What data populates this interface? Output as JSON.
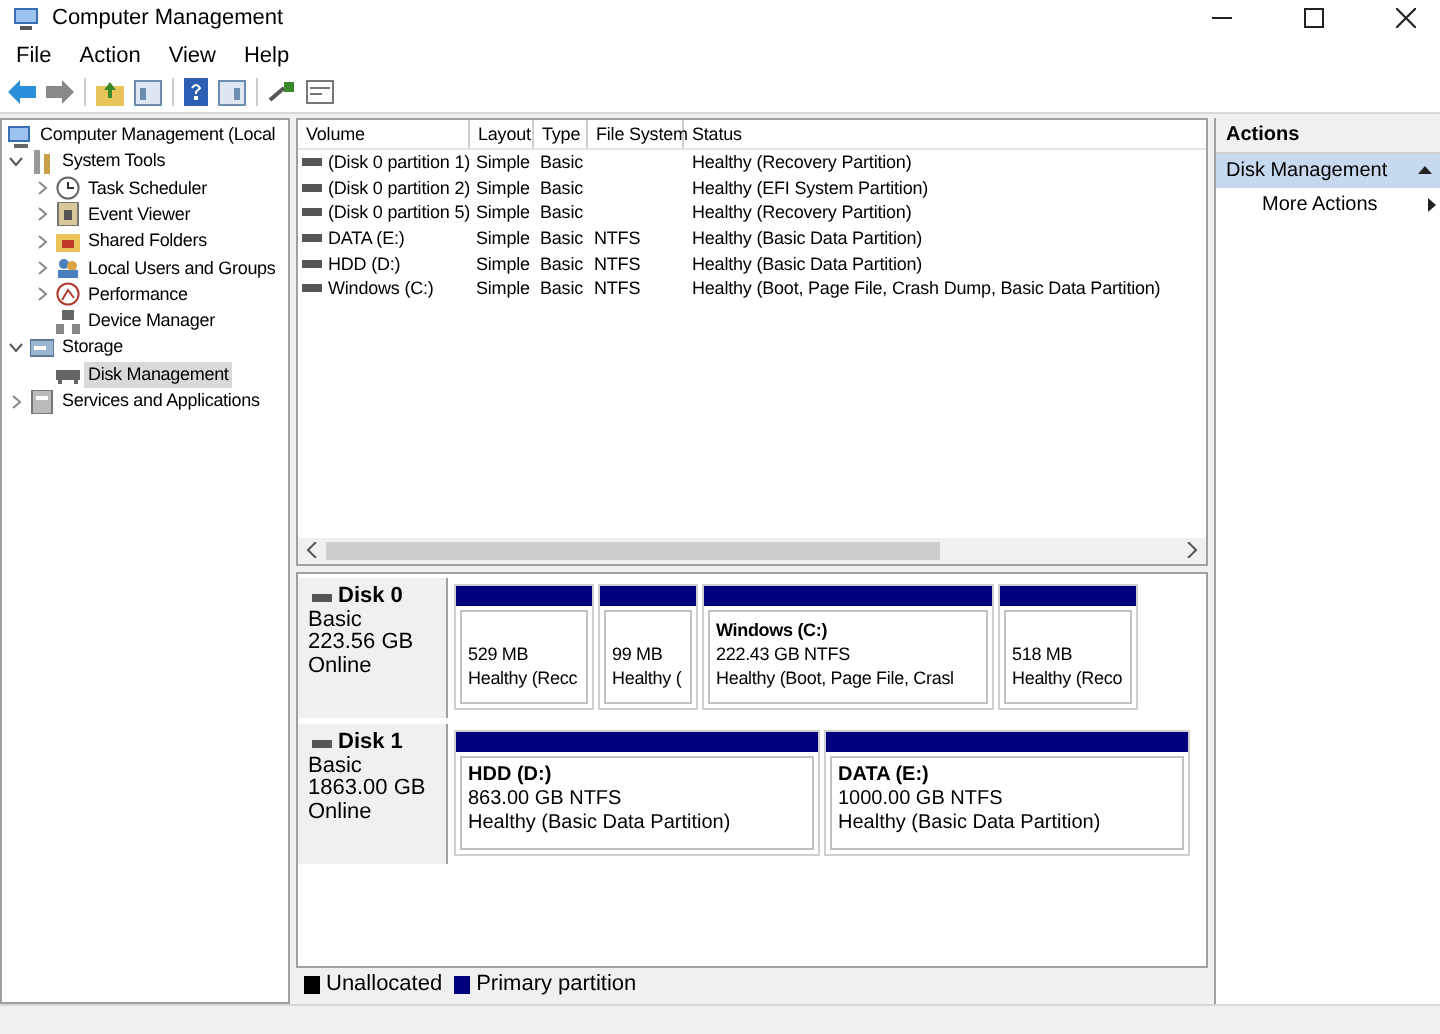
{
  "window": {
    "title": "Computer Management"
  },
  "menu": [
    "File",
    "Action",
    "View",
    "Help"
  ],
  "tree": [
    {
      "label": "Computer Management (Local",
      "kind": "computer",
      "selected": false,
      "children": [
        {
          "label": "System Tools",
          "kind": "tools",
          "expanded": true,
          "selected": false,
          "children": [
            {
              "label": "Task Scheduler",
              "kind": "clock",
              "expanded": false,
              "selected": false
            },
            {
              "label": "Event Viewer",
              "kind": "log",
              "expanded": false,
              "selected": false
            },
            {
              "label": "Shared Folders",
              "kind": "folder",
              "expanded": false,
              "selected": false
            },
            {
              "label": "Local Users and Groups",
              "kind": "users",
              "expanded": false,
              "selected": false
            },
            {
              "label": "Performance",
              "kind": "gauge",
              "expanded": false,
              "selected": false
            },
            {
              "label": "Device Manager",
              "kind": "devices",
              "selected": false
            }
          ]
        },
        {
          "label": "Storage",
          "kind": "storage",
          "expanded": true,
          "selected": false,
          "children": [
            {
              "label": "Disk Management",
              "kind": "disk",
              "selected": true
            }
          ]
        },
        {
          "label": "Services and Applications",
          "kind": "services",
          "expanded": false,
          "selected": false
        }
      ]
    }
  ],
  "table": {
    "columns": [
      "Volume",
      "Layout",
      "Type",
      "File System",
      "Status"
    ],
    "rows": [
      [
        "(Disk 0 partition 1)",
        "Simple",
        "Basic",
        "",
        "Healthy (Recovery Partition)"
      ],
      [
        "(Disk 0 partition 2)",
        "Simple",
        "Basic",
        "",
        "Healthy (EFI System Partition)"
      ],
      [
        "(Disk 0 partition 5)",
        "Simple",
        "Basic",
        "",
        "Healthy (Recovery Partition)"
      ],
      [
        "DATA (E:)",
        "Simple",
        "Basic",
        "NTFS",
        "Healthy (Basic Data Partition)"
      ],
      [
        "HDD (D:)",
        "Simple",
        "Basic",
        "NTFS",
        "Healthy (Basic Data Partition)"
      ],
      [
        "Windows (C:)",
        "Simple",
        "Basic",
        "NTFS",
        "Healthy (Boot, Page File, Crash Dump, Basic Data Partition)"
      ]
    ]
  },
  "disks": [
    {
      "name": "Disk 0",
      "type": "Basic",
      "size": "223.56 GB",
      "status": "Online",
      "partitions": [
        {
          "kind": "small",
          "size": "529 MB",
          "status": "Healthy (Recc"
        },
        {
          "kind": "tiny",
          "size": "99 MB",
          "status": "Healthy ("
        },
        {
          "kind": "large",
          "label": "Windows  (C:)",
          "size": "222.43 GB NTFS",
          "status": "Healthy (Boot, Page File, Crasl"
        },
        {
          "kind": "small",
          "size": "518 MB",
          "status": "Healthy (Reco"
        }
      ]
    },
    {
      "name": "Disk 1",
      "type": "Basic",
      "size": "1863.00 GB",
      "status": "Online",
      "partitions": [
        {
          "kind": "half",
          "label": "HDD  (D:)",
          "size": "863.00 GB NTFS",
          "status": "Healthy (Basic Data Partition)"
        },
        {
          "kind": "half",
          "label": "DATA  (E:)",
          "size": "1000.00 GB NTFS",
          "status": "Healthy (Basic Data Partition)"
        }
      ]
    }
  ],
  "legend": [
    {
      "label": "Unallocated",
      "color": "#000000"
    },
    {
      "label": "Primary partition",
      "color": "#00007f"
    }
  ],
  "actions": {
    "title": "Actions",
    "groups": [
      {
        "label": "Disk Management",
        "expanded": true,
        "items": [
          "More Actions"
        ]
      }
    ]
  }
}
